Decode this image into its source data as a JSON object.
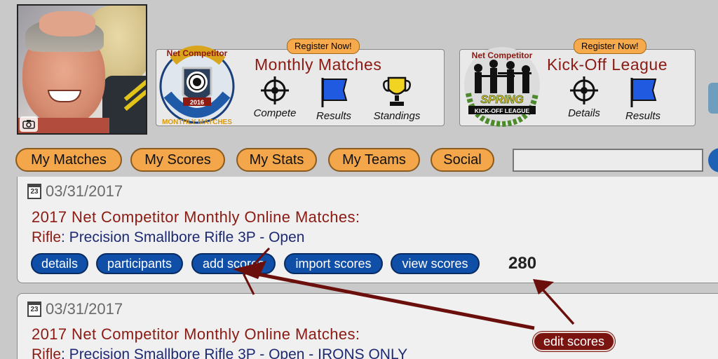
{
  "header": {
    "monthly": {
      "badge_top_text": "Net Competitor",
      "badge_year": "2016",
      "badge_bottom_text": "MONTHLY MATCHES",
      "register_label": "Register Now!",
      "title": "Monthly Matches",
      "links": [
        {
          "label": "Compete",
          "icon": "crosshair-icon"
        },
        {
          "label": "Results",
          "icon": "flag-icon"
        },
        {
          "label": "Standings",
          "icon": "trophy-icon"
        }
      ]
    },
    "kickoff": {
      "badge_top_text": "Net Competitor",
      "badge_spring": "SPRING",
      "badge_bottom_text": "KICK-OFF LEAGUE",
      "register_label": "Register Now!",
      "title": "Kick-Off League",
      "links": [
        {
          "label": "Details",
          "icon": "crosshair-icon"
        },
        {
          "label": "Results",
          "icon": "flag-icon"
        }
      ]
    }
  },
  "nav": {
    "items": [
      "My Matches",
      "My Scores",
      "My Stats",
      "My Teams",
      "Social"
    ],
    "search_value": ""
  },
  "matches": [
    {
      "calendar_day": "23",
      "date": "03/31/2017",
      "title": "2017 Net Competitor Monthly Online Matches:",
      "discipline_type": "Rifle",
      "discipline_name": ": Precision Smallbore Rifle 3P - Open",
      "actions": [
        "details",
        "participants",
        "add scores",
        "import scores",
        "view scores"
      ],
      "score": "280"
    },
    {
      "calendar_day": "23",
      "date": "03/31/2017",
      "title": "2017 Net Competitor Monthly Online Matches:",
      "discipline_type": "Rifle",
      "discipline_name": ": Precision Smallbore Rifle 3P - Open - IRONS ONLY"
    }
  ],
  "annotation": {
    "edit_scores_label": "edit scores"
  },
  "colors": {
    "accent_orange": "#f4a64b",
    "button_blue": "#0f4fa8",
    "title_red": "#8b1a12",
    "arrow_maroon": "#6b0f0c"
  }
}
